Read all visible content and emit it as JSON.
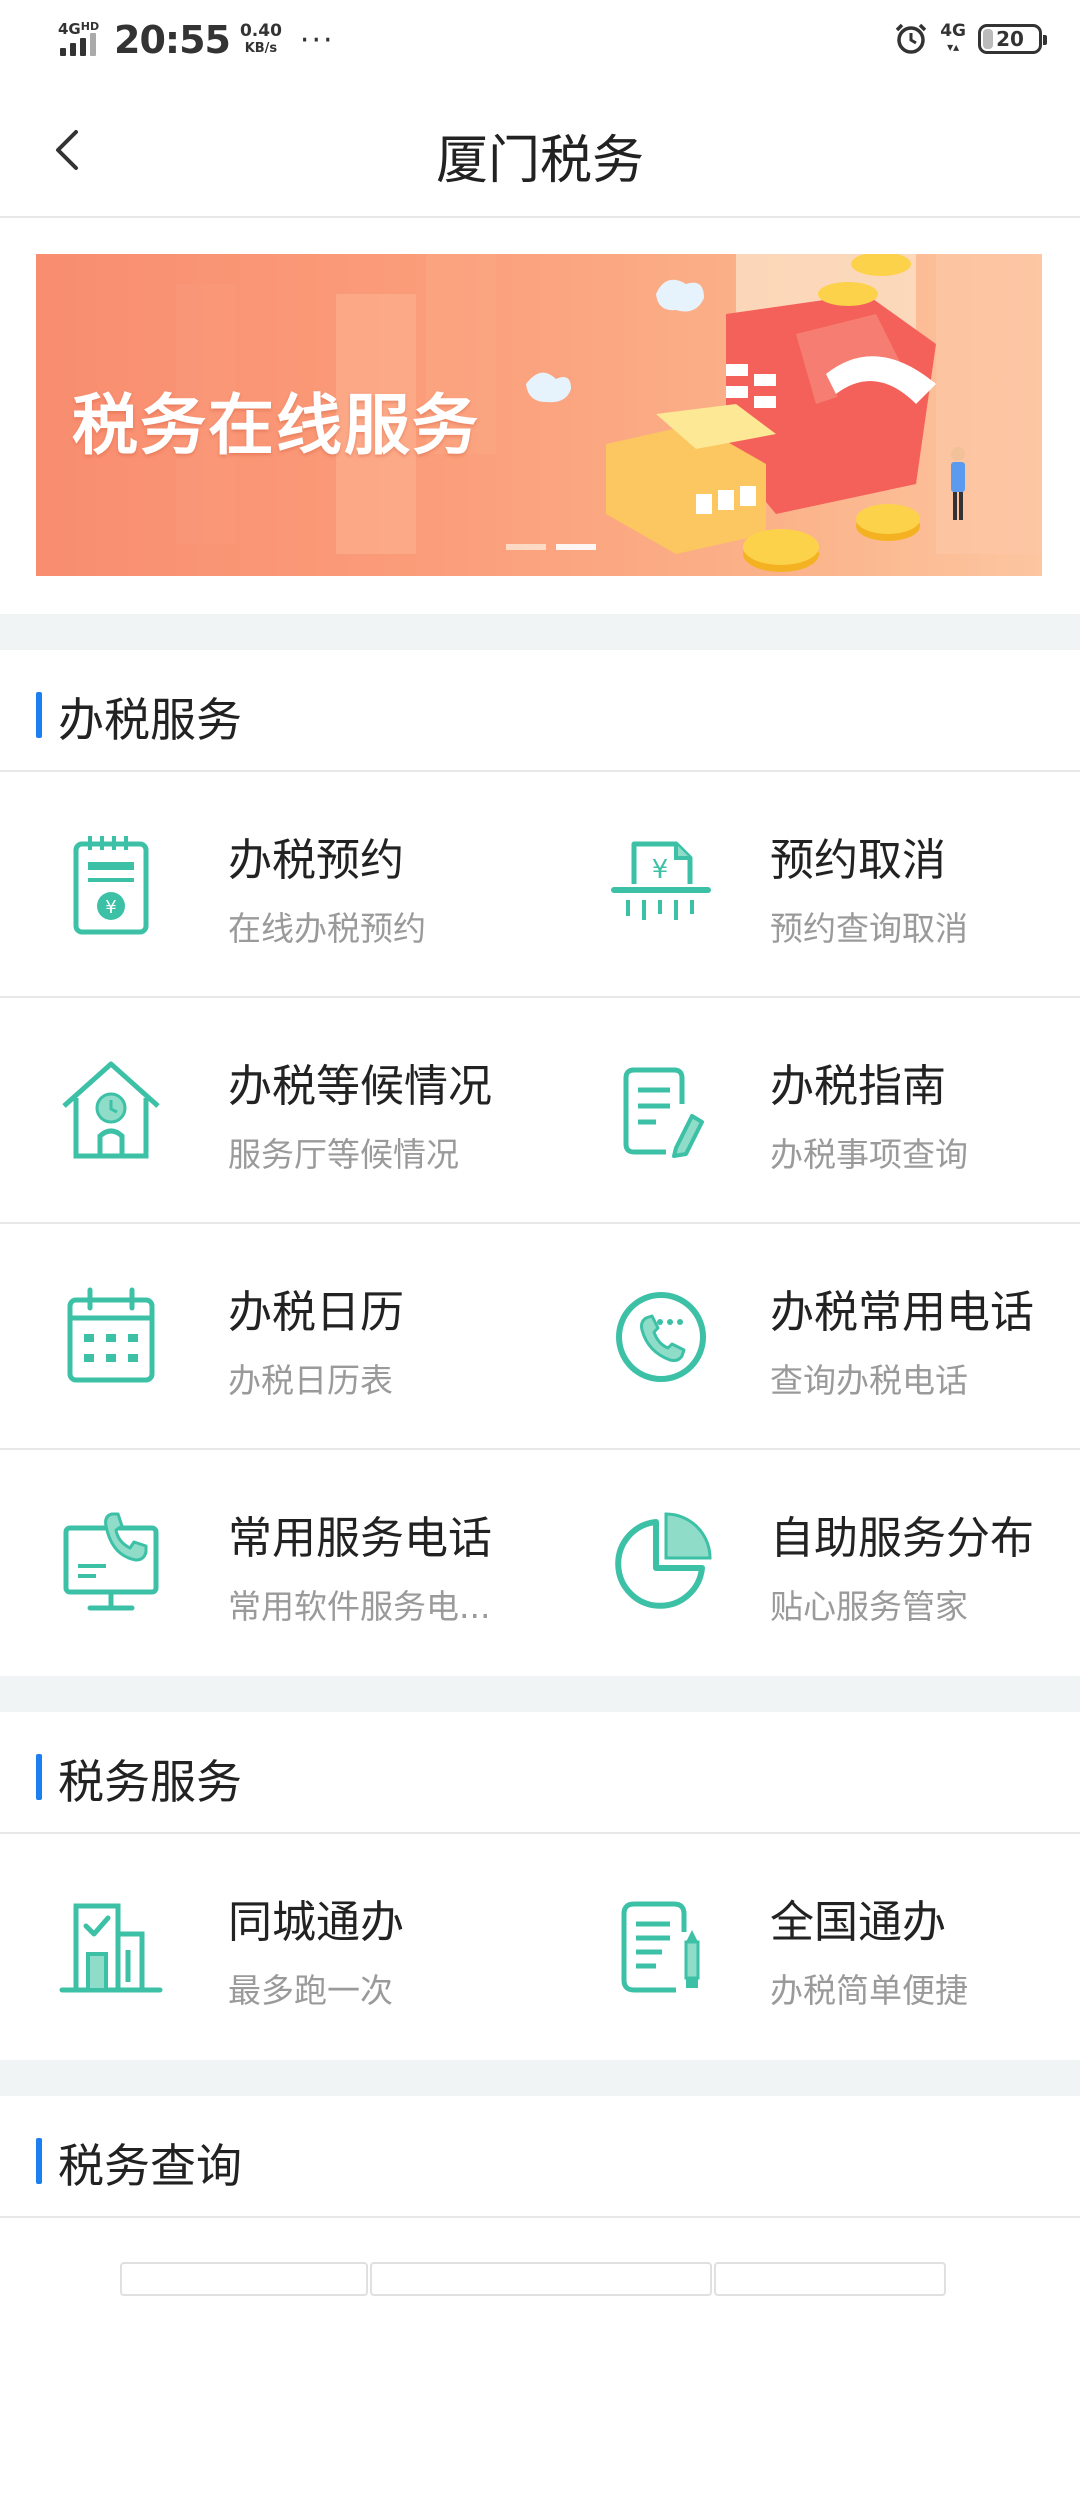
{
  "status_bar": {
    "network": "4G",
    "network_sup": "HD",
    "time": "20:55",
    "speed_value": "0.40",
    "speed_unit": "KB/s",
    "more": "···",
    "net_right": "4G",
    "battery": "20"
  },
  "header": {
    "title": "厦门税务"
  },
  "banner": {
    "text": "税务在线服务"
  },
  "sections": [
    {
      "title": "办税服务",
      "items": [
        {
          "title": "办税预约",
          "subtitle": "在线办税预约",
          "icon": "clipboard-yen-icon"
        },
        {
          "title": "预约取消",
          "subtitle": "预约查询取消",
          "icon": "shredder-yen-icon"
        },
        {
          "title": "办税等候情况",
          "subtitle": "服务厅等候情况",
          "icon": "house-clock-icon"
        },
        {
          "title": "办税指南",
          "subtitle": "办税事项查询",
          "icon": "document-pen-icon"
        },
        {
          "title": "办税日历",
          "subtitle": "办税日历表",
          "icon": "calendar-icon"
        },
        {
          "title": "办税常用电话",
          "subtitle": "查询办税电话",
          "icon": "phone-circle-icon"
        },
        {
          "title": "常用服务电话",
          "subtitle": "常用软件服务电...",
          "icon": "monitor-phone-icon"
        },
        {
          "title": "自助服务分布",
          "subtitle": "贴心服务管家",
          "icon": "pie-chart-icon"
        }
      ]
    },
    {
      "title": "税务服务",
      "items": [
        {
          "title": "同城通办",
          "subtitle": "最多跑一次",
          "icon": "building-check-icon"
        },
        {
          "title": "全国通办",
          "subtitle": "办税简单便捷",
          "icon": "document-pencil-icon"
        }
      ]
    },
    {
      "title": "税务查询",
      "items": []
    }
  ],
  "colors": {
    "accent": "#1b7ff0",
    "icon": "#3cc1a6",
    "banner_start": "#f88d6f",
    "banner_end": "#fcc6a0"
  }
}
